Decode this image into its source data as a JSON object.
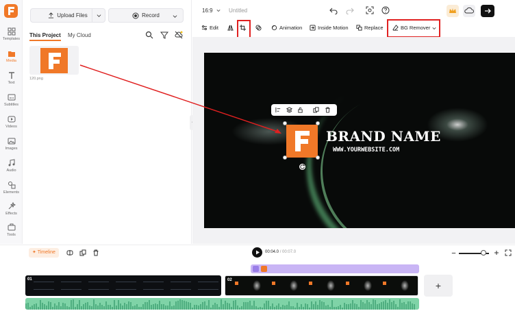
{
  "rail": {
    "items": [
      {
        "label": "Templates",
        "icon": "templates-icon"
      },
      {
        "label": "Media",
        "icon": "media-icon"
      },
      {
        "label": "Text",
        "icon": "text-icon"
      },
      {
        "label": "Subtitles",
        "icon": "subtitles-icon"
      },
      {
        "label": "Videos",
        "icon": "videos-icon"
      },
      {
        "label": "Images",
        "icon": "images-icon"
      },
      {
        "label": "Audio",
        "icon": "audio-icon"
      },
      {
        "label": "Elements",
        "icon": "elements-icon"
      },
      {
        "label": "Effects",
        "icon": "effects-icon"
      },
      {
        "label": "Tools",
        "icon": "tools-icon"
      }
    ]
  },
  "panel": {
    "upload_label": "Upload Files",
    "record_label": "Record",
    "tabs": [
      {
        "label": "This Project"
      },
      {
        "label": "My Cloud"
      }
    ],
    "thumb_name": "120.png",
    "thumb_letter": "F"
  },
  "topbar": {
    "ratio": "16:9",
    "title": "Untitled"
  },
  "toolbar": {
    "edit": "Edit",
    "animation": "Animation",
    "inside_motion": "Inside Motion",
    "replace": "Replace",
    "bg_remover": "BG Remover"
  },
  "canvas": {
    "brand": "BRAND NAME",
    "website": "WWW.YOURWEBSITE.COM",
    "logo_letter": "F"
  },
  "timeline": {
    "label": "Timeline",
    "current_time": "00:04.0",
    "separator": " / ",
    "total_time": "00:07.0",
    "clip1_num": "01",
    "clip2_num": "02",
    "add_label": "+"
  },
  "colors": {
    "accent": "#f07828",
    "highlight": "#e02020",
    "overlay_track": "#c9b5f5",
    "audio_track": "#7fd3a7"
  }
}
